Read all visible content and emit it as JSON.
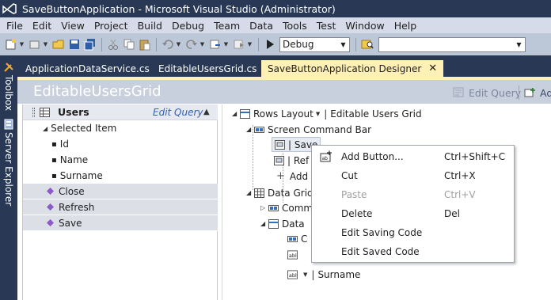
{
  "window": {
    "title": "SaveButtonApplication - Microsoft Visual Studio (Administrator)"
  },
  "menu": [
    "File",
    "Edit",
    "View",
    "Project",
    "Build",
    "Debug",
    "Team",
    "Data",
    "Tools",
    "Test",
    "Window",
    "Help"
  ],
  "toolbar": {
    "config_value": "Debug",
    "search_value": ""
  },
  "side_tabs": {
    "toolbox": "Toolbox",
    "server_explorer": "Server Explorer"
  },
  "doc_tabs": [
    {
      "label": "ApplicationDataService.cs"
    },
    {
      "label": "EditableUsersGrid.cs"
    },
    {
      "label": "SaveButtonApplication Designer",
      "close": "✕"
    }
  ],
  "designer": {
    "title": "EditableUsersGrid",
    "edit_query": "Edit Query",
    "add_label": "Ad"
  },
  "left_pane": {
    "header": "Users",
    "edit_query": "Edit Query",
    "selected_item": "Selected Item",
    "fields": [
      "Id",
      "Name",
      "Surname"
    ],
    "commands": [
      "Close",
      "Refresh",
      "Save"
    ]
  },
  "tree": {
    "rows_layout": "Rows Layout",
    "root_name": "Editable Users Grid",
    "screen_command_bar": "Screen Command Bar",
    "save_item": "| Save",
    "refresh_item": "| Ref",
    "add": "Add",
    "data_grid": "Data Grid",
    "commands": "Comm",
    "data_row": "Data",
    "c_item": "C",
    "surname": "Surname"
  },
  "context_menu": {
    "items": [
      {
        "label": "Add Button...",
        "shortcut": "Ctrl+Shift+C",
        "enabled": true
      },
      {
        "label": "Cut",
        "shortcut": "Ctrl+X",
        "enabled": true
      },
      {
        "label": "Paste",
        "shortcut": "Ctrl+V",
        "enabled": false
      },
      {
        "label": "Delete",
        "shortcut": "Del",
        "enabled": true
      },
      {
        "label": "Edit Saving Code",
        "shortcut": "",
        "enabled": true
      },
      {
        "label": "Edit Saved Code",
        "shortcut": "",
        "enabled": true
      }
    ]
  }
}
